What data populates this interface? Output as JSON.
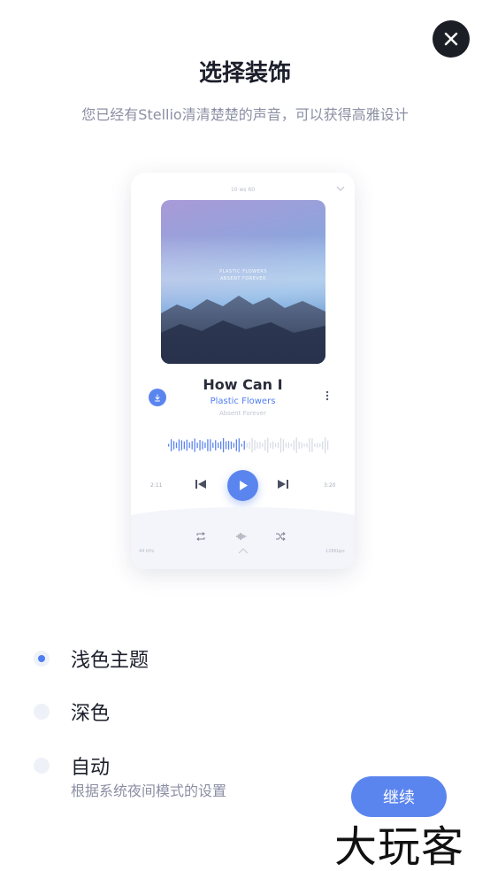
{
  "header": {
    "title": "选择装饰",
    "subtitle": "您已经有Stellio清清楚楚的声音，可以获得高雅设计"
  },
  "preview": {
    "clock": "10 ws 60",
    "album_line1": "PLASTIC FLOWERS",
    "album_line2": "ABSENT FOREVER",
    "song_title": "How Can I",
    "artist": "Plastic Flowers",
    "album": "Absent Forever",
    "elapsed": "2:11",
    "total": "3:20",
    "sample_rate": "44 kHz",
    "bitrate": "128Kbps",
    "accent_color": "#5b85ee"
  },
  "options": [
    {
      "label": "浅色主题",
      "selected": true
    },
    {
      "label": "深色",
      "selected": false
    },
    {
      "label": "自动",
      "selected": false,
      "description": "根据系统夜间模式的设置"
    }
  ],
  "continue_label": "继续",
  "watermark": "大玩客",
  "icons": [
    "close-icon",
    "chevron-down-icon",
    "download-icon",
    "more-vertical-icon",
    "skip-previous-icon",
    "play-icon",
    "skip-next-icon",
    "repeat-icon",
    "equalizer-icon",
    "shuffle-icon",
    "chevron-up-icon"
  ]
}
